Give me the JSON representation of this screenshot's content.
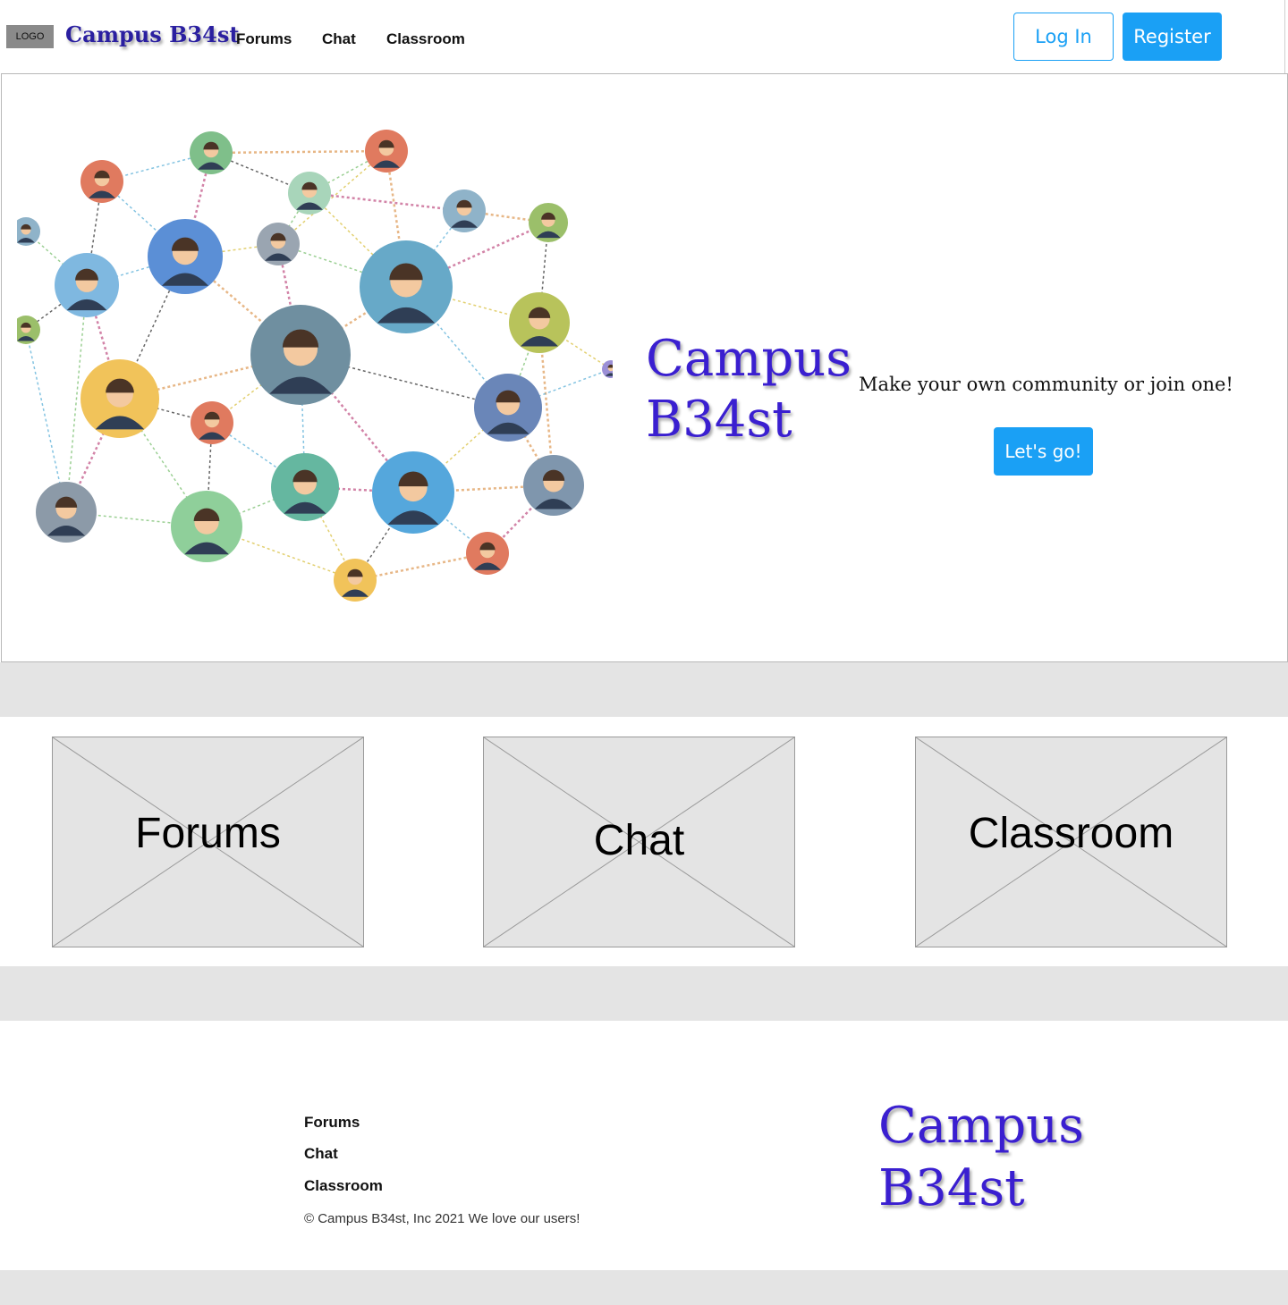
{
  "header": {
    "logo_text": "LOGO",
    "brand": "Campus B34st",
    "nav": [
      "Forums",
      "Chat",
      "Classroom"
    ],
    "login_label": "Log In",
    "register_label": "Register"
  },
  "hero": {
    "title_line1": "Campus",
    "title_line2": "B34st",
    "tagline": "Make your own community or join one!",
    "cta_label": "Let's go!",
    "illustration": "people-network-illustration"
  },
  "features": [
    "Forums",
    "Chat",
    "Classroom"
  ],
  "footer": {
    "links": [
      "Forums",
      "Chat",
      "Classroom"
    ],
    "copyright": "© Campus B34st, Inc 2021 We love our users!",
    "brand_line1": "Campus",
    "brand_line2": "B34st"
  },
  "colors": {
    "accent": "#1aa0f5",
    "brand": "#3a1fd0",
    "band": "#e4e4e4"
  }
}
